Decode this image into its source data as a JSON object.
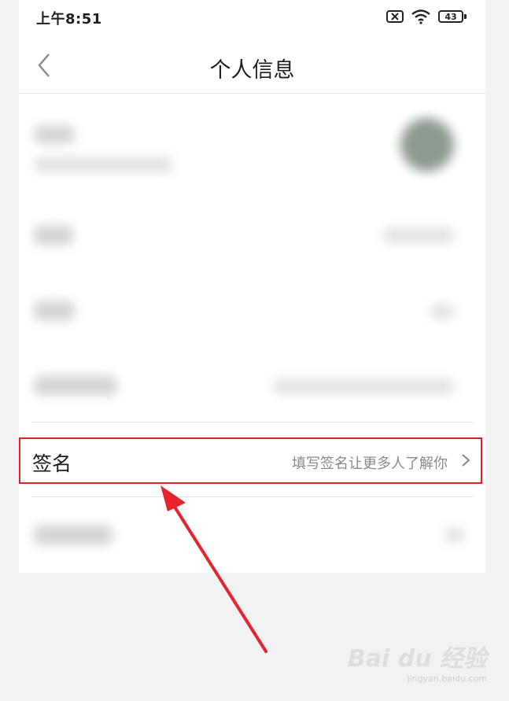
{
  "status_bar": {
    "time": "上午8:51",
    "battery": "43"
  },
  "nav": {
    "title": "个人信息"
  },
  "signature": {
    "label": "签名",
    "hint": "填写签名让更多人了解你"
  },
  "watermark": {
    "main": "Bai du 经验",
    "sub": "jingyan.baidu.com"
  },
  "colors": {
    "highlight": "#d9232d",
    "bottom_area": "#f2f2f4"
  }
}
